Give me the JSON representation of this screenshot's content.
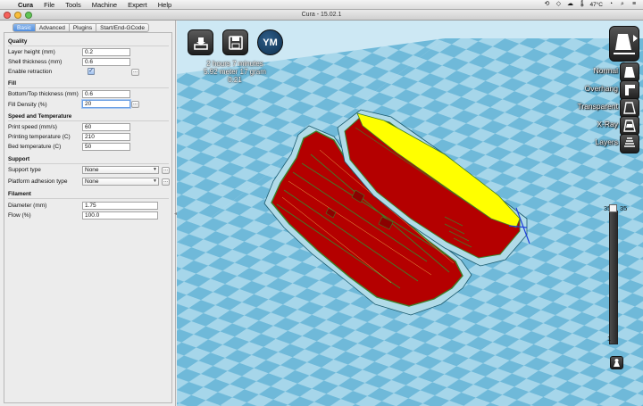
{
  "menubar": {
    "app": "Cura",
    "items": [
      "File",
      "Tools",
      "Machine",
      "Expert",
      "Help"
    ],
    "temperature": "47°C"
  },
  "window": {
    "title": "Cura - 15.02.1"
  },
  "tabs": [
    {
      "label": "Basic",
      "active": true
    },
    {
      "label": "Advanced",
      "active": false
    },
    {
      "label": "Plugins",
      "active": false
    },
    {
      "label": "Start/End-GCode",
      "active": false
    }
  ],
  "quality": {
    "title": "Quality",
    "layer_height_label": "Layer height (mm)",
    "layer_height": "0.2",
    "shell_label": "Shell thickness (mm)",
    "shell": "0.6",
    "retraction_label": "Enable retraction",
    "retraction_checked": true
  },
  "fill": {
    "title": "Fill",
    "bottom_top_label": "Bottom/Top thickness (mm)",
    "bottom_top": "0.6",
    "density_label": "Fill Density (%)",
    "density": "20"
  },
  "speed": {
    "title": "Speed and Temperature",
    "print_speed_label": "Print speed (mm/s)",
    "print_speed": "60",
    "print_temp_label": "Printing temperature (C)",
    "print_temp": "210",
    "bed_temp_label": "Bed temperature (C)",
    "bed_temp": "50"
  },
  "support": {
    "title": "Support",
    "type_label": "Support type",
    "type": "None",
    "adhesion_label": "Platform adhesion type",
    "adhesion": "None"
  },
  "filament": {
    "title": "Filament",
    "diameter_label": "Diameter (mm)",
    "diameter": "1.75",
    "flow_label": "Flow (%)",
    "flow": "100.0"
  },
  "toolbar": {
    "load_icon": "load-model-icon",
    "save_icon": "save-icon",
    "ym_label": "YM"
  },
  "print_info": {
    "time": "2 hours 7 minutes",
    "material": "5.92 meter 17 gram",
    "cost": "0.21"
  },
  "view_modes": [
    "Normal",
    "Overhang",
    "Transparent",
    "X-Ray",
    "Layers"
  ],
  "layer_slider": {
    "top": "35",
    "current": "35",
    "bottom": "1"
  },
  "colors": {
    "bed_dark": "#6fb9d9",
    "bed_light": "#a6d6ea",
    "shell": "#b40000",
    "top_fill": "#ffff00",
    "outline": "#3d7f2a"
  }
}
